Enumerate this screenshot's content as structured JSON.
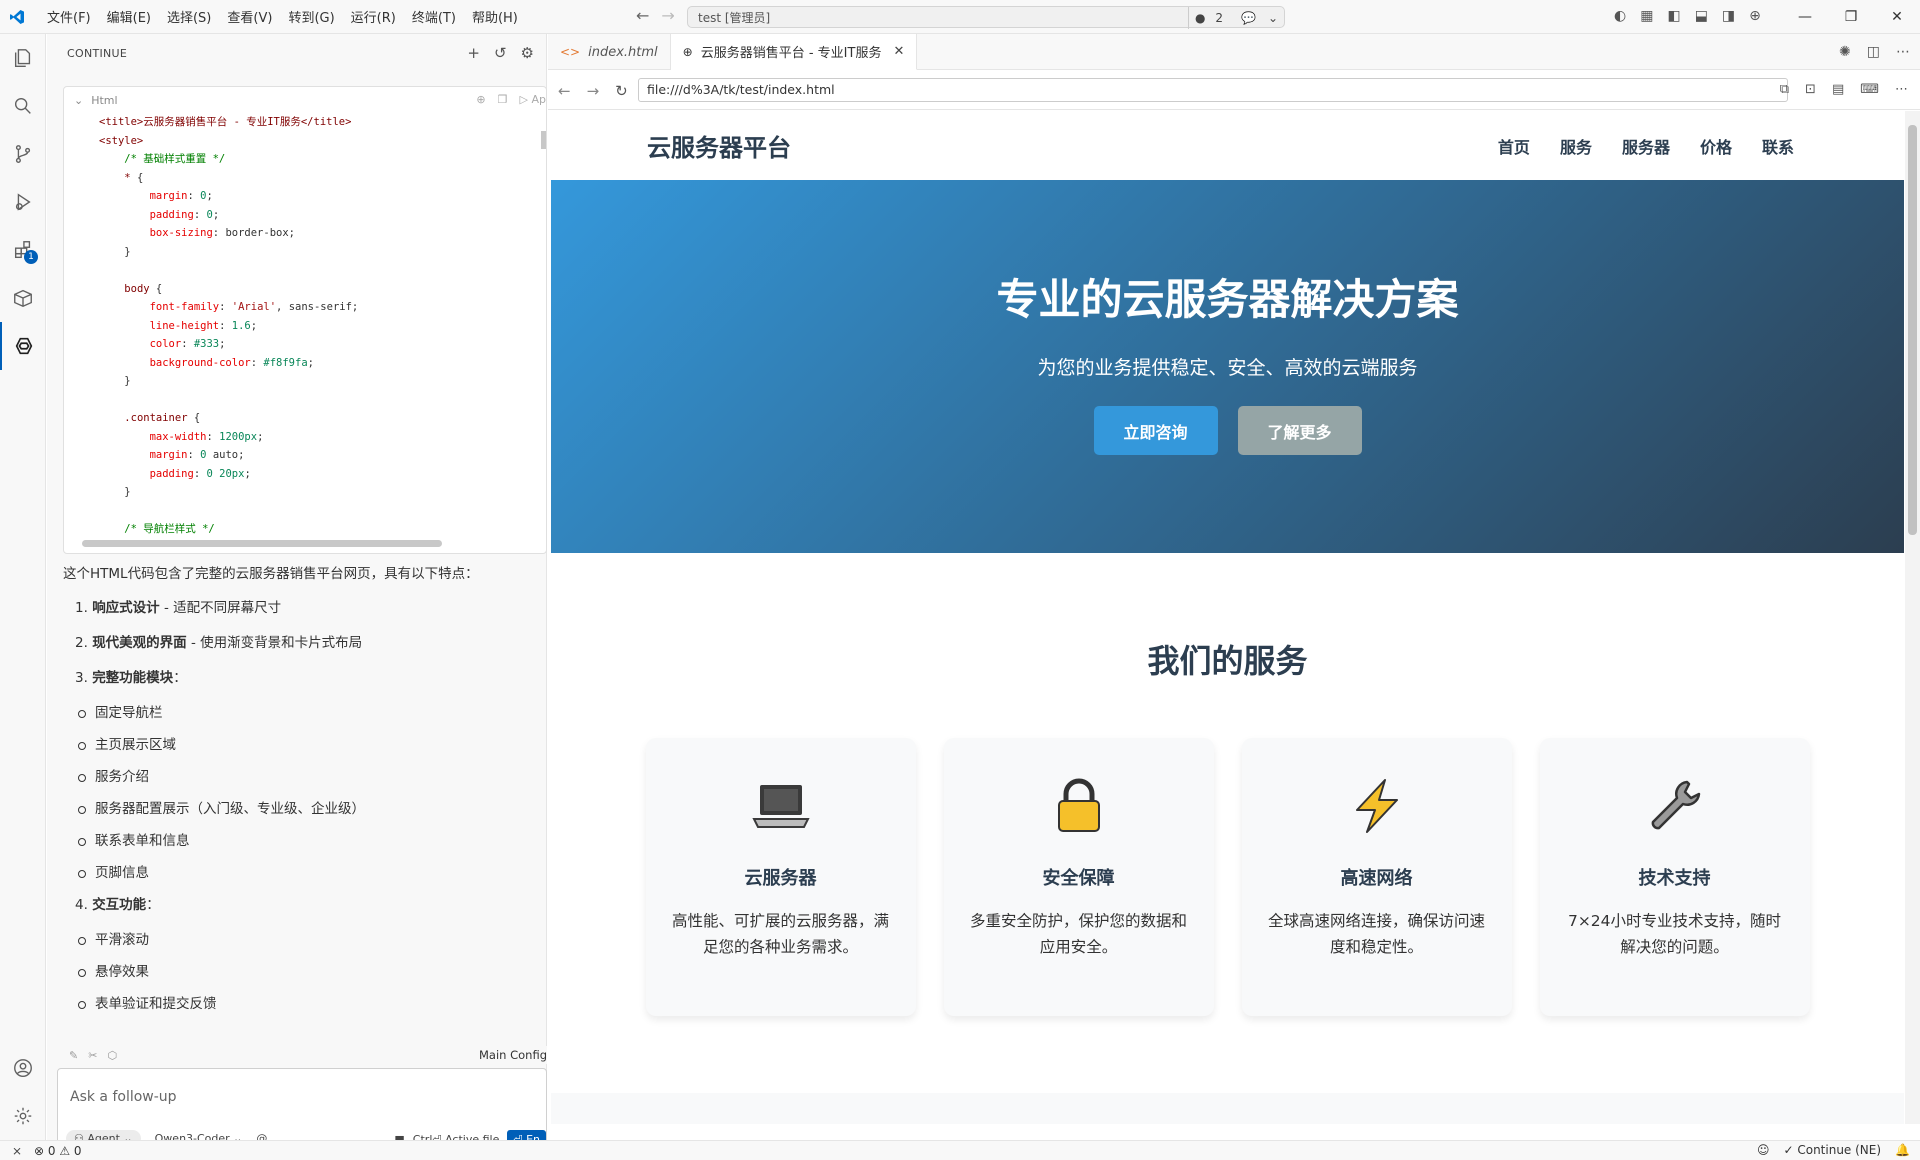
{
  "menu": [
    "文件(F)",
    "编辑(E)",
    "选择(S)",
    "查看(V)",
    "转到(G)",
    "运行(R)",
    "终端(T)",
    "帮助(H)"
  ],
  "command_center": {
    "text": "test [管理员]",
    "count": "2"
  },
  "side_panel": {
    "title": "CONTINUE",
    "code_block": {
      "lang": "Html",
      "apply_label": "Ap",
      "lines": [
        "<title>云服务器销售平台 - 专业IT服务</title>",
        "<style>",
        "    /* 基础样式重置 */",
        "    * {",
        "        margin: 0;",
        "        padding: 0;",
        "        box-sizing: border-box;",
        "    }",
        "",
        "    body {",
        "        font-family: 'Arial', sans-serif;",
        "        line-height: 1.6;",
        "        color: #333;",
        "        background-color: #f8f9fa;",
        "    }",
        "",
        "    .container {",
        "        max-width: 1200px;",
        "        margin: 0 auto;",
        "        padding: 0 20px;",
        "    }",
        "",
        "    /* 导航栏样式 */"
      ]
    },
    "answer": {
      "intro": "这个HTML代码包含了完整的云服务器销售平台网页，具有以下特点：",
      "items": [
        {
          "num": "1.",
          "bold": "响应式设计",
          "rest": " - 适配不同屏幕尺寸"
        },
        {
          "num": "2.",
          "bold": "现代美观的界面",
          "rest": " - 使用渐变背景和卡片式布局"
        },
        {
          "num": "3.",
          "bold": "完整功能模块",
          "rest": "："
        }
      ],
      "bullets3": [
        "固定导航栏",
        "主页展示区域",
        "服务介绍",
        "服务器配置展示（入门级、专业级、企业级）",
        "联系表单和信息",
        "页脚信息"
      ],
      "item4": {
        "num": "4.",
        "bold": "交互功能",
        "rest": "："
      },
      "bullets4": [
        "平滑滚动",
        "悬停效果",
        "表单验证和提交反馈"
      ]
    },
    "config_label": "Main Config",
    "input": {
      "placeholder": "Ask a follow-up",
      "mode": "Agent",
      "model": "Qwen3-Coder",
      "at": "@",
      "active_file": "Ctrl⏎ Active file",
      "enter": "⏎ En"
    }
  },
  "tabs": [
    {
      "label": "index.html",
      "icon": "code-icon"
    },
    {
      "label": "云服务器销售平台 - 专业IT服务",
      "icon": "globe-icon"
    }
  ],
  "browser": {
    "url": "file:///d%3A/tk/test/index.html"
  },
  "webpage": {
    "logo": "云服务器平台",
    "nav": [
      "首页",
      "服务",
      "服务器",
      "价格",
      "联系"
    ],
    "hero": {
      "title": "专业的云服务器解决方案",
      "subtitle": "为您的业务提供稳定、安全、高效的云端服务",
      "primary_btn": "立即咨询",
      "secondary_btn": "了解更多"
    },
    "services": {
      "title": "我们的服务",
      "cards": [
        {
          "icon": "laptop-icon",
          "title": "云服务器",
          "desc": "高性能、可扩展的云服务器，满足您的各种业务需求。"
        },
        {
          "icon": "lock-icon",
          "title": "安全保障",
          "desc": "多重安全防护，保护您的数据和应用安全。"
        },
        {
          "icon": "lightning-icon",
          "title": "高速网络",
          "desc": "全球高速网络连接，确保访问速度和稳定性。"
        },
        {
          "icon": "wrench-icon",
          "title": "技术支持",
          "desc": "7×24小时专业技术支持，随时解决您的问题。"
        }
      ]
    }
  },
  "statusbar": {
    "errors": "0",
    "warnings": "0",
    "continue": "Continue (NE)"
  },
  "colors": {
    "accent": "#005fb8",
    "hero_start": "#3498db",
    "hero_end": "#2c3e50",
    "btn_secondary": "#95a5a6",
    "heading": "#2c3e50"
  }
}
